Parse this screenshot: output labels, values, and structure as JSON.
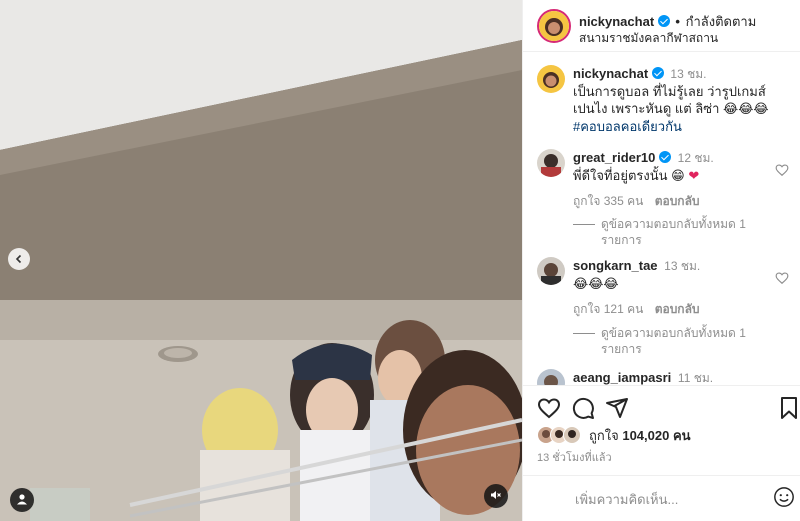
{
  "post": {
    "author": "nickynachat",
    "follow_status": "กำลังติดตาม",
    "location": "สนามราชมังคลากีฬาสถาน"
  },
  "caption": {
    "username": "nickynachat",
    "time": "13 ชม.",
    "text": "เป็นการดูบอล ที่ไม่รู้เลย ว่ารูปเกมส์เปนไง เพราะหันดู แต่ ลิซ่า",
    "emojis": "😂😂😂",
    "hashtag": "#คอบอลคอเดียวกัน"
  },
  "comments": [
    {
      "username": "great_rider10",
      "time": "12 ชม.",
      "text": "พี่ดีใจที่อยู่ตรงนั้น",
      "emojis": "😁",
      "heart": "❤",
      "likes": "ถูกใจ 335 คน",
      "reply_label": "ตอบกลับ",
      "view_replies": "ดูข้อความตอบกลับทั้งหมด 1 รายการ"
    },
    {
      "username": "songkarn_tae",
      "time": "13 ชม.",
      "emojis": "😂😂😂",
      "likes": "ถูกใจ 121 คน",
      "reply_label": "ตอบกลับ",
      "view_replies": "ดูข้อความตอบกลับทั้งหมด 1 รายการ"
    },
    {
      "username": "aeang_iampasri",
      "time": "11 ชม."
    }
  ],
  "likes_summary": {
    "prefix": "ถูกใจ",
    "count": "104,020",
    "suffix": "คน"
  },
  "posted_time": "13 ชั่วโมงที่แล้ว",
  "add_comment": {
    "placeholder": "เพิ่มความคิดเห็น..."
  },
  "colors": {
    "verified": "#0095f6",
    "link": "#00376b",
    "secondary_text": "#8e8e8e",
    "border": "#efefef"
  },
  "icons": [
    "chevron-left-icon",
    "tag-user-icon",
    "muted-speaker-icon",
    "verified-icon",
    "heart-icon",
    "comment-icon",
    "share-icon",
    "bookmark-icon",
    "emoji-icon"
  ]
}
